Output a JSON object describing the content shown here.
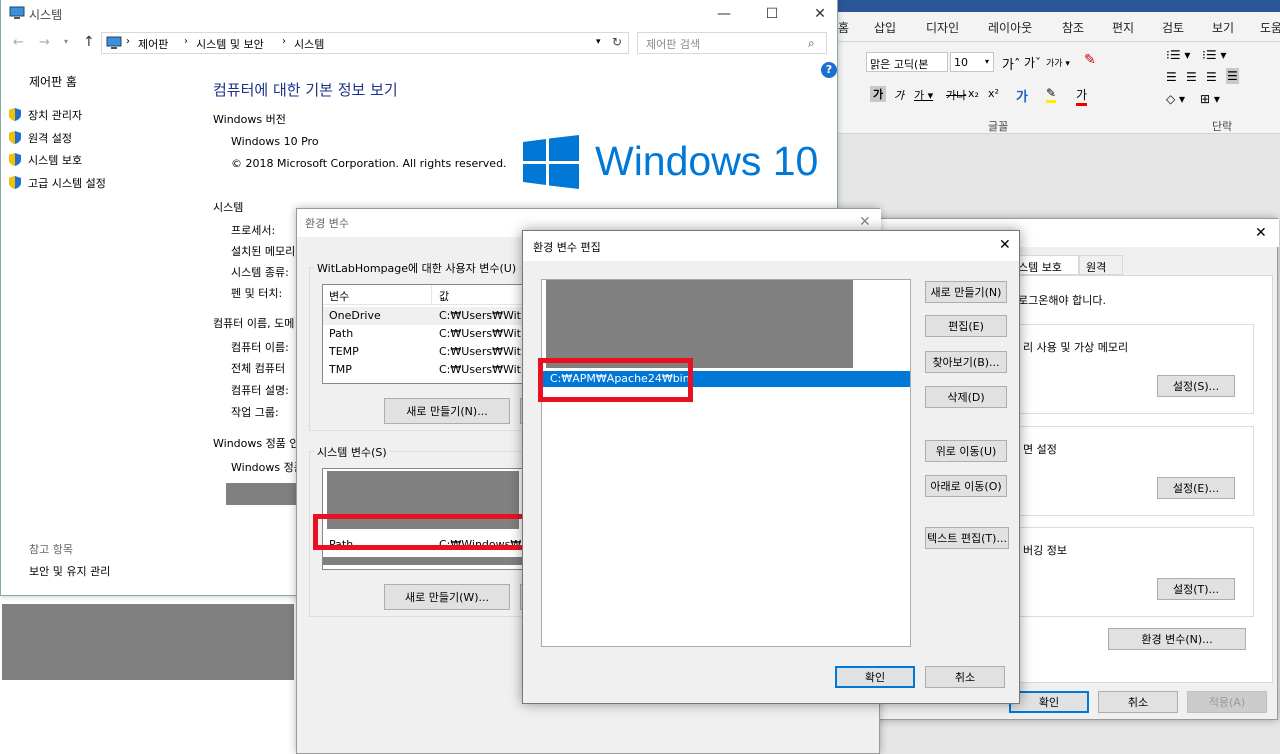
{
  "system_window": {
    "title": "시스템",
    "breadcrumb": [
      "제어판",
      "시스템 및 보안",
      "시스템"
    ],
    "search_placeholder": "제어판 검색",
    "sidebar_home": "제어판 홈",
    "sidebar_links": [
      "장치 관리자",
      "원격 설정",
      "시스템 보호",
      "고급 시스템 설정"
    ],
    "see_also_label": "참고 항목",
    "see_also_link": "보안 및 유지 관리",
    "heading": "컴퓨터에 대한 기본 정보 보기",
    "edition_label": "Windows 버전",
    "edition": "Windows 10 Pro",
    "copyright": "© 2018 Microsoft Corporation. All rights reserved.",
    "logo_text": "Windows 10",
    "system_label": "시스템",
    "system_rows": [
      "프로세서:",
      "설치된 메모리",
      "시스템 종류:",
      "펜 및 터치:"
    ],
    "computer_label": "컴퓨터 이름, 도메",
    "computer_rows": [
      "컴퓨터 이름:",
      "전체 컴퓨터",
      "컴퓨터 설명:",
      "작업 그룹:"
    ],
    "activation_label": "Windows 정품 인",
    "activation_row": "Windows 정품"
  },
  "word_ribbon": {
    "tabs": [
      "홈",
      "삽입",
      "디자인",
      "레이아웃",
      "참조",
      "편지",
      "검토",
      "보기",
      "도움"
    ],
    "font_name": "맑은 고딕(본",
    "font_size": "10",
    "font_group_label": "글꼴",
    "paragraph_group_label": "단락",
    "font_color_glyph": "가"
  },
  "env_window": {
    "title": "환경 변수",
    "user_group_label": "WitLabHompage에 대한 사용자 변수(U)",
    "col_var": "변수",
    "col_val": "값",
    "user_vars": [
      {
        "name": "OneDrive",
        "value": "C:₩Users₩WitLab"
      },
      {
        "name": "Path",
        "value": "C:₩Users₩WitLab"
      },
      {
        "name": "TEMP",
        "value": "C:₩Users₩WitLab"
      },
      {
        "name": "TMP",
        "value": "C:₩Users₩WitLab"
      }
    ],
    "user_new_btn": "새로 만들기(N)...",
    "system_group_label": "시스템 변수(S)",
    "system_path_name": "Path",
    "system_path_value": "C:₩Windows₩sys",
    "system_new_btn": "새로 만들기(W)..."
  },
  "sysprops_window": {
    "tabs": [
      "스템 보호",
      "원격"
    ],
    "admin_note": "로그온해야 합니다.",
    "perf_text": "리 사용 및 가상 메모리",
    "profile_text": "면 설정",
    "startup_text": "버깅 정보",
    "settings_btn1": "설정(S)...",
    "settings_btn2": "설정(E)...",
    "settings_btn3": "설정(T)...",
    "env_btn": "환경 변수(N)...",
    "ok_btn": "확인",
    "cancel_btn": "취소",
    "apply_btn": "적용(A)"
  },
  "edit_dialog": {
    "title": "환경 변수 편집",
    "selected_entry": "C:₩APM₩Apache24₩bin",
    "buttons": {
      "new": "새로 만들기(N)",
      "edit": "편집(E)",
      "browse": "찾아보기(B)...",
      "delete": "삭제(D)",
      "move_up": "위로 이동(U)",
      "move_down": "아래로 이동(O)",
      "edit_text": "텍스트 편집(T)...",
      "ok": "확인",
      "cancel": "취소"
    }
  },
  "colors": {
    "selection": "#0078d7",
    "highlight_box": "#e81123",
    "redacted": "#808080",
    "word_blue": "#2b579a"
  }
}
